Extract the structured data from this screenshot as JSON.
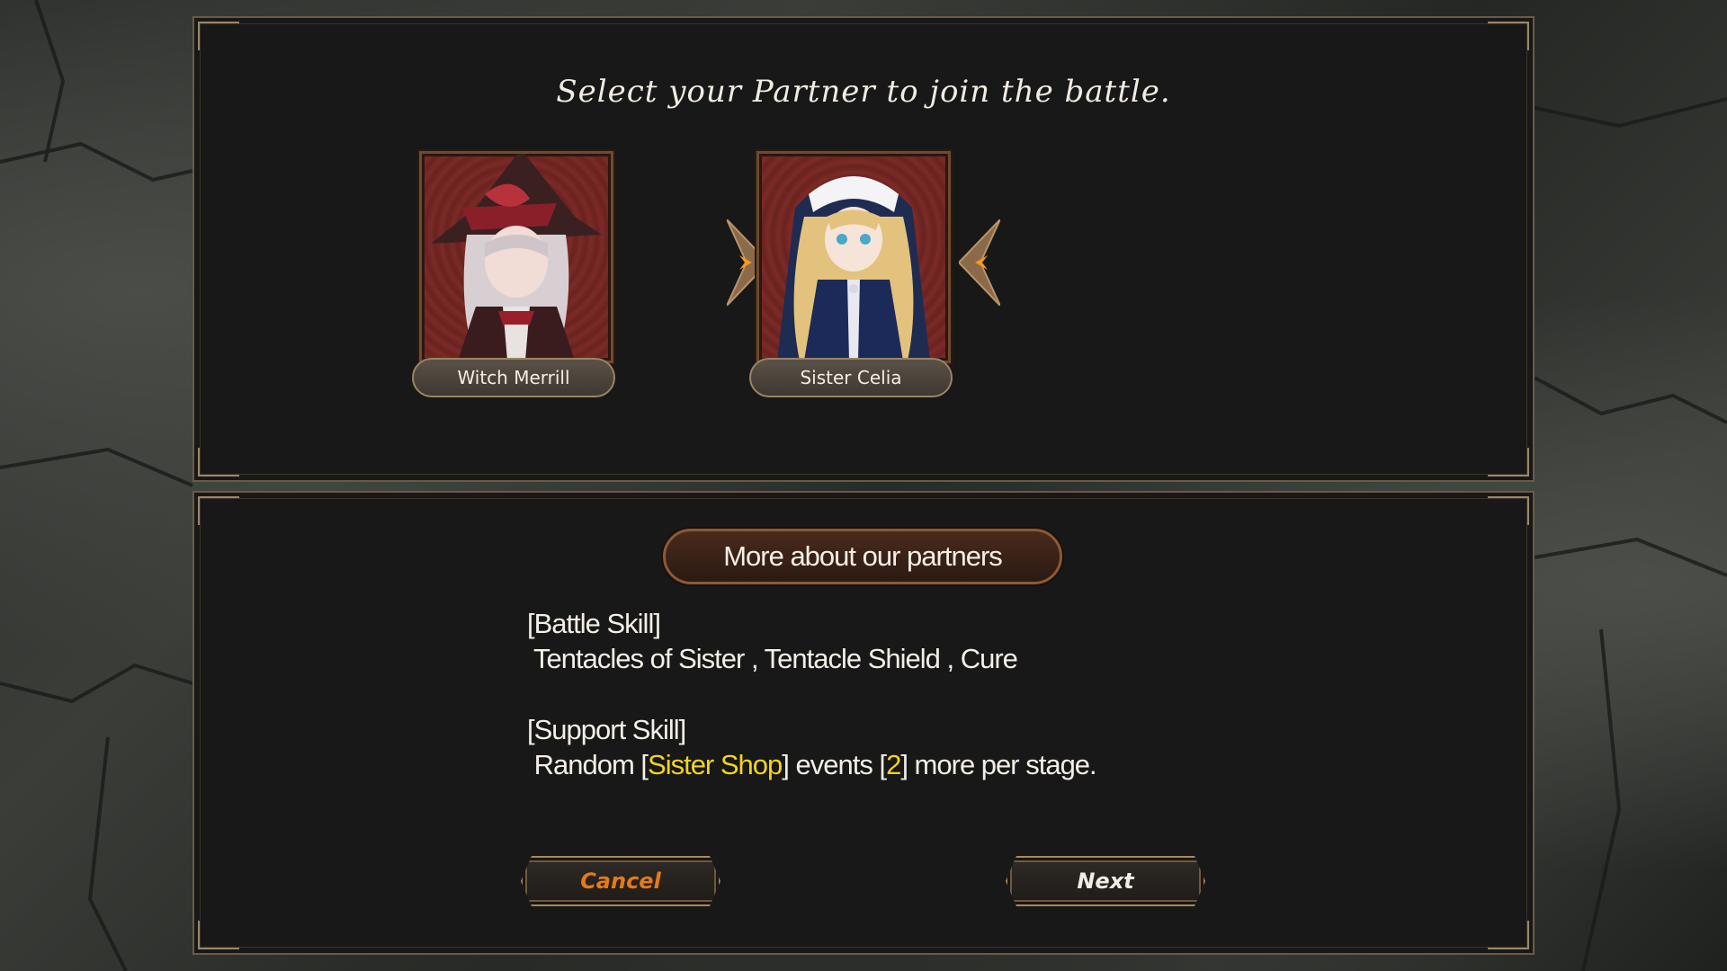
{
  "dialog": {
    "prompt": "Select your Partner to join the battle."
  },
  "partners": [
    {
      "name": "Witch Merrill",
      "selected": false
    },
    {
      "name": "Sister Celia",
      "selected": true
    }
  ],
  "details": {
    "more_button": "More about our partners",
    "battle_skill_header": "[Battle Skill]",
    "battle_skills": " Tentacles of Sister , Tentacle Shield , Cure",
    "support_skill_header": "[Support Skill]",
    "support_prefix": " Random [",
    "support_highlight1": "Sister Shop",
    "support_mid": "] events [",
    "support_highlight2": "2",
    "support_suffix": "] more per stage."
  },
  "buttons": {
    "cancel": "Cancel",
    "next": "Next"
  },
  "colors": {
    "highlight": "#f3d41e",
    "cancel_text": "#e47a1a",
    "panel_bg": "#181818",
    "frame_gold": "#9c8463"
  }
}
